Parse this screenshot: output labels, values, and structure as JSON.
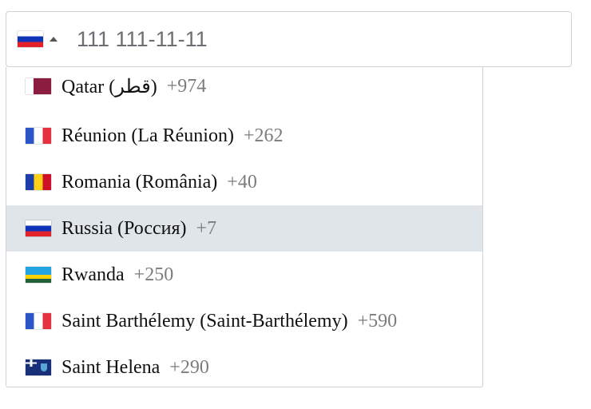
{
  "phone": {
    "selected_flag": "ru",
    "placeholder": "111 111-11-11",
    "value": ""
  },
  "options": [
    {
      "flag": "qa",
      "name": "Qatar (‫قطر‬‎)",
      "dial": "+974"
    },
    {
      "flag": "fr",
      "name": "Réunion (La Réunion)",
      "dial": "+262"
    },
    {
      "flag": "ro",
      "name": "Romania (România)",
      "dial": "+40"
    },
    {
      "flag": "ru",
      "name": "Russia (Россия)",
      "dial": "+7"
    },
    {
      "flag": "rw",
      "name": "Rwanda",
      "dial": "+250"
    },
    {
      "flag": "fr",
      "name": "Saint Barthélemy (Saint-Barthélemy)",
      "dial": "+590"
    },
    {
      "flag": "sh",
      "name": "Saint Helena",
      "dial": "+290"
    }
  ],
  "highlighted_index": 3,
  "colors": {
    "highlight": "#dfe5e8",
    "border": "#cfd3d7",
    "dial_code": "#7c7c7c"
  }
}
